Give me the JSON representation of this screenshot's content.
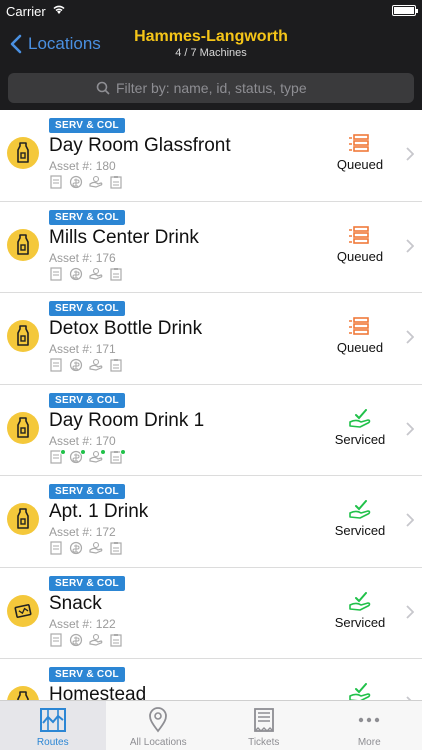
{
  "status_bar": {
    "carrier": "Carrier",
    "time": ""
  },
  "nav": {
    "back_label": "Locations",
    "title": "Hammes-Langworth",
    "subtitle": "4 / 7 Machines"
  },
  "search": {
    "placeholder": "Filter by: name, id, status, type"
  },
  "rows": [
    {
      "tag": "SERV & COL",
      "name": "Day Room Glassfront",
      "asset": "Asset #: 180",
      "status": "Queued",
      "icon": "bottle-icon",
      "dots": false
    },
    {
      "tag": "SERV & COL",
      "name": "Mills Center Drink",
      "asset": "Asset #: 176",
      "status": "Queued",
      "icon": "bottle-icon",
      "dots": false
    },
    {
      "tag": "SERV & COL",
      "name": "Detox Bottle Drink",
      "asset": "Asset #: 171",
      "status": "Queued",
      "icon": "bottle-icon",
      "dots": false
    },
    {
      "tag": "SERV & COL",
      "name": "Day Room Drink 1",
      "asset": "Asset #: 170",
      "status": "Serviced",
      "icon": "bottle-icon",
      "dots": true
    },
    {
      "tag": "SERV & COL",
      "name": "Apt. 1 Drink",
      "asset": "Asset #: 172",
      "status": "Serviced",
      "icon": "bottle-icon",
      "dots": false
    },
    {
      "tag": "SERV & COL",
      "name": "Snack",
      "asset": "Asset #: 122",
      "status": "Serviced",
      "icon": "snack-icon",
      "dots": false
    },
    {
      "tag": "SERV & COL",
      "name": "Homestead",
      "asset": "",
      "status": "",
      "icon": "bottle-icon",
      "dots": false
    }
  ],
  "tabs": [
    {
      "label": "Routes",
      "active": true,
      "icon": "map-icon"
    },
    {
      "label": "All Locations",
      "active": false,
      "icon": "location-pin-icon"
    },
    {
      "label": "Tickets",
      "active": false,
      "icon": "ticket-icon"
    },
    {
      "label": "More",
      "active": false,
      "icon": "more-dots-icon"
    }
  ],
  "colors": {
    "accent": "#2c86d4",
    "title": "#f5c518",
    "queued": "#f07a3a",
    "serviced": "#21c14a",
    "avatar": "#f4c83b"
  }
}
